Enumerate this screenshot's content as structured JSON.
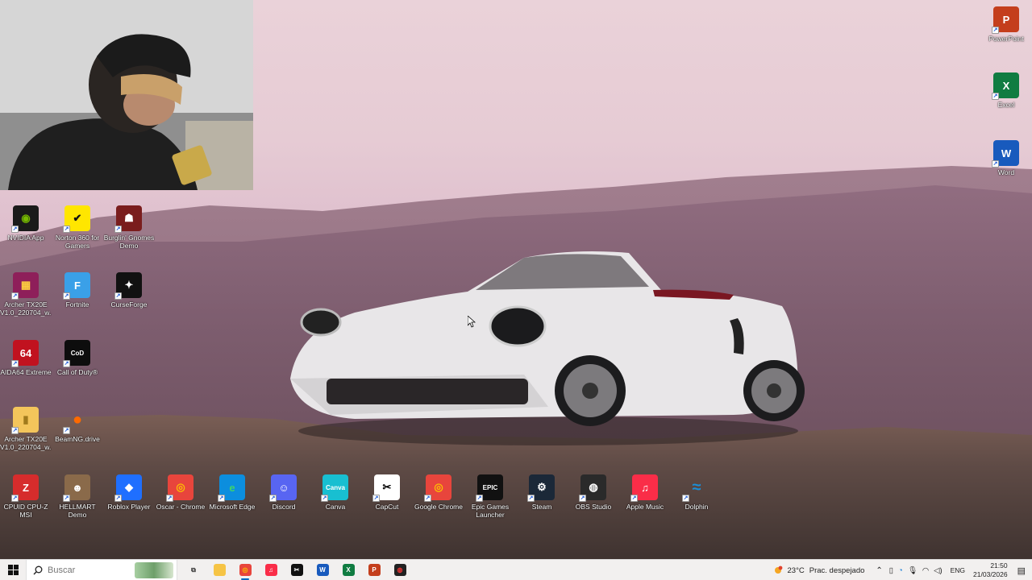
{
  "desktop": {
    "icons_left": [
      {
        "label": "NVIDIA App",
        "glyph": "◉",
        "color": "#1a1a1a",
        "fg": "#76b900"
      },
      {
        "label": "Norton 360 for Gamers",
        "glyph": "✔",
        "color": "#ffe600",
        "fg": "#111"
      },
      {
        "label": "Burglin' Gnomes Demo",
        "glyph": "☗",
        "color": "#7a1d1d",
        "fg": "#fff"
      },
      {
        "label": "Archer TX20E V1.0_220704_w...",
        "glyph": "▦",
        "color": "#8e1f5a",
        "fg": "#ffd23f"
      },
      {
        "label": "Fortnite",
        "glyph": "F",
        "color": "#3aa0e8",
        "fg": "#fff"
      },
      {
        "label": "CurseForge",
        "glyph": "✦",
        "color": "#111",
        "fg": "#fff"
      },
      {
        "label": "AIDA64 Extreme",
        "glyph": "64",
        "color": "#c1121f",
        "fg": "#fff"
      },
      {
        "label": "Call of Duty®",
        "glyph": "CoD",
        "color": "#0d0d0d",
        "fg": "#fff"
      },
      {
        "label": "Archer TX20E V1.0_220704_w...",
        "glyph": "▮",
        "color": "#f3c55b",
        "fg": "#a07a1c"
      },
      {
        "label": "BeamNG.drive",
        "glyph": "●",
        "color": "transparent",
        "fg": "#ff6a00"
      }
    ],
    "icons_right": [
      {
        "label": "PowerPoint",
        "glyph": "P",
        "color": "#c43e1c",
        "fg": "#fff"
      },
      {
        "label": "Excel",
        "glyph": "X",
        "color": "#107c41",
        "fg": "#fff"
      },
      {
        "label": "Word",
        "glyph": "W",
        "color": "#185abd",
        "fg": "#fff"
      }
    ],
    "icons_bottom": [
      {
        "label": "CPUID CPU-Z MSI",
        "glyph": "Z",
        "color": "#d62c2c",
        "fg": "#fff"
      },
      {
        "label": "HELLMART Demo",
        "glyph": "☻",
        "color": "#8a6a4a",
        "fg": "#fff"
      },
      {
        "label": "Roblox Player",
        "glyph": "◆",
        "color": "#1f6fff",
        "fg": "#fff"
      },
      {
        "label": "Oscar - Chrome",
        "glyph": "◎",
        "color": "#e8453c",
        "fg": "#fbbc05"
      },
      {
        "label": "Microsoft Edge",
        "glyph": "e",
        "color": "#0c8ede",
        "fg": "#3fd46a"
      },
      {
        "label": "Discord",
        "glyph": "☺",
        "color": "#5865f2",
        "fg": "#fff"
      },
      {
        "label": "Canva",
        "glyph": "Canva",
        "color": "#18bfd1",
        "fg": "#fff"
      },
      {
        "label": "CapCut",
        "glyph": "✂",
        "color": "#ffffff",
        "fg": "#000"
      },
      {
        "label": "Google Chrome",
        "glyph": "◎",
        "color": "#e8453c",
        "fg": "#fbbc05"
      },
      {
        "label": "Epic Games Launcher",
        "glyph": "EPIC",
        "color": "#111",
        "fg": "#fff"
      },
      {
        "label": "Steam",
        "glyph": "⚙",
        "color": "#1b2838",
        "fg": "#fff"
      },
      {
        "label": "OBS Studio",
        "glyph": "◍",
        "color": "#2a2a2a",
        "fg": "#fff"
      },
      {
        "label": "Apple Music",
        "glyph": "♫",
        "color": "#fa2d48",
        "fg": "#fff"
      },
      {
        "label": "Dolphin",
        "glyph": "≈",
        "color": "transparent",
        "fg": "#1a8fd8"
      }
    ]
  },
  "taskbar": {
    "search_placeholder": "Buscar",
    "apps": [
      {
        "name": "task-view",
        "glyph": "⧉",
        "color": "transparent",
        "fg": "#333"
      },
      {
        "name": "file-explorer",
        "glyph": "▬",
        "color": "#f6c445",
        "fg": "#f6c445"
      },
      {
        "name": "chrome",
        "glyph": "◎",
        "color": "#e8453c",
        "fg": "#fbbc05",
        "active": true
      },
      {
        "name": "apple-music",
        "glyph": "♫",
        "color": "#fa2d48",
        "fg": "#fff"
      },
      {
        "name": "capcut",
        "glyph": "✂",
        "color": "#111",
        "fg": "#fff"
      },
      {
        "name": "word",
        "glyph": "W",
        "color": "#185abd",
        "fg": "#fff"
      },
      {
        "name": "excel",
        "glyph": "X",
        "color": "#107c41",
        "fg": "#fff"
      },
      {
        "name": "powerpoint",
        "glyph": "P",
        "color": "#c43e1c",
        "fg": "#fff"
      },
      {
        "name": "obs",
        "glyph": "◍",
        "color": "#222",
        "fg": "#e33"
      }
    ],
    "weather_temp": "23°C",
    "weather_text": "Prac. despejado",
    "language": "ENG",
    "time": "21:50",
    "date": "21/03/2026"
  }
}
